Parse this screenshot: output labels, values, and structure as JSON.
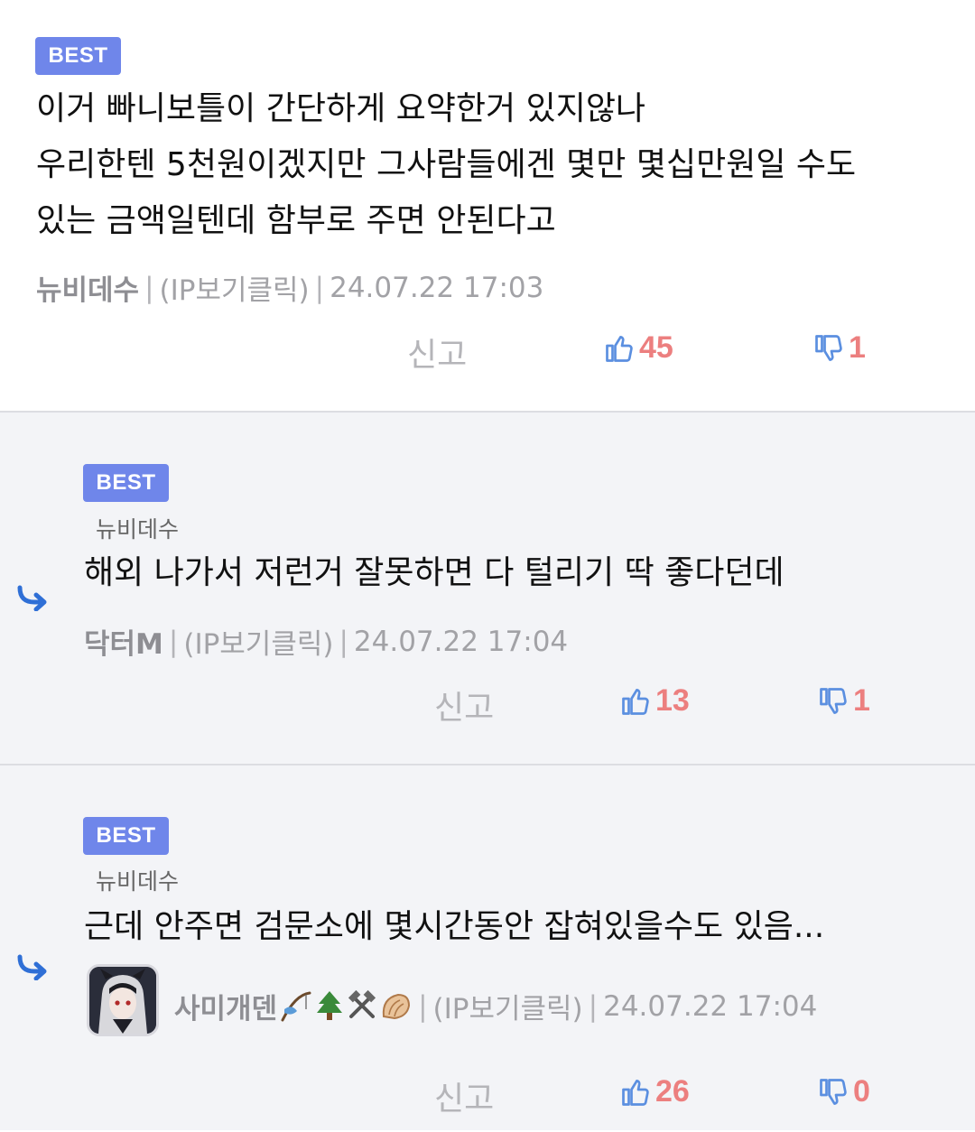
{
  "comments": [
    {
      "badge": "BEST",
      "lines": [
        "이거 빠니보틀이 간단하게 요약한거 있지않나",
        "우리한텐 5천원이겠지만 그사람들에겐 몇만 몇십만원일 수도",
        "있는 금액일텐데 함부로 주면 안된다고"
      ],
      "author": "뉴비데수",
      "ip": "(IP보기클릭)",
      "time": "24.07.22 17:03",
      "report": "신고",
      "likes": "45",
      "dislikes": "1"
    },
    {
      "badge": "BEST",
      "reply_to": "뉴비데수",
      "lines": [
        "해외 나가서 저런거 잘못하면 다 털리기 딱 좋다던데"
      ],
      "author": "닥터M",
      "ip": "(IP보기클릭)",
      "time": "24.07.22 17:04",
      "report": "신고",
      "likes": "13",
      "dislikes": "1"
    },
    {
      "badge": "BEST",
      "reply_to": "뉴비데수",
      "lines": [
        "근데 안주면 검문소에 몇시간동안 잡혀있을수도 있음..."
      ],
      "author": "사미개덴",
      "author_emoji": [
        "fishing-rod-icon",
        "tree-icon",
        "hammer-pick-icon",
        "shell-icon"
      ],
      "ip": "(IP보기클릭)",
      "time": "24.07.22 17:04",
      "report": "신고",
      "likes": "26",
      "dislikes": "0"
    }
  ],
  "colors": {
    "badge": "#6f86ea",
    "like_icon": "#5b8fe0",
    "count": "#ec7f7f",
    "reply_arrow": "#2f6fd6",
    "reply_bg": "#f3f4f7"
  }
}
